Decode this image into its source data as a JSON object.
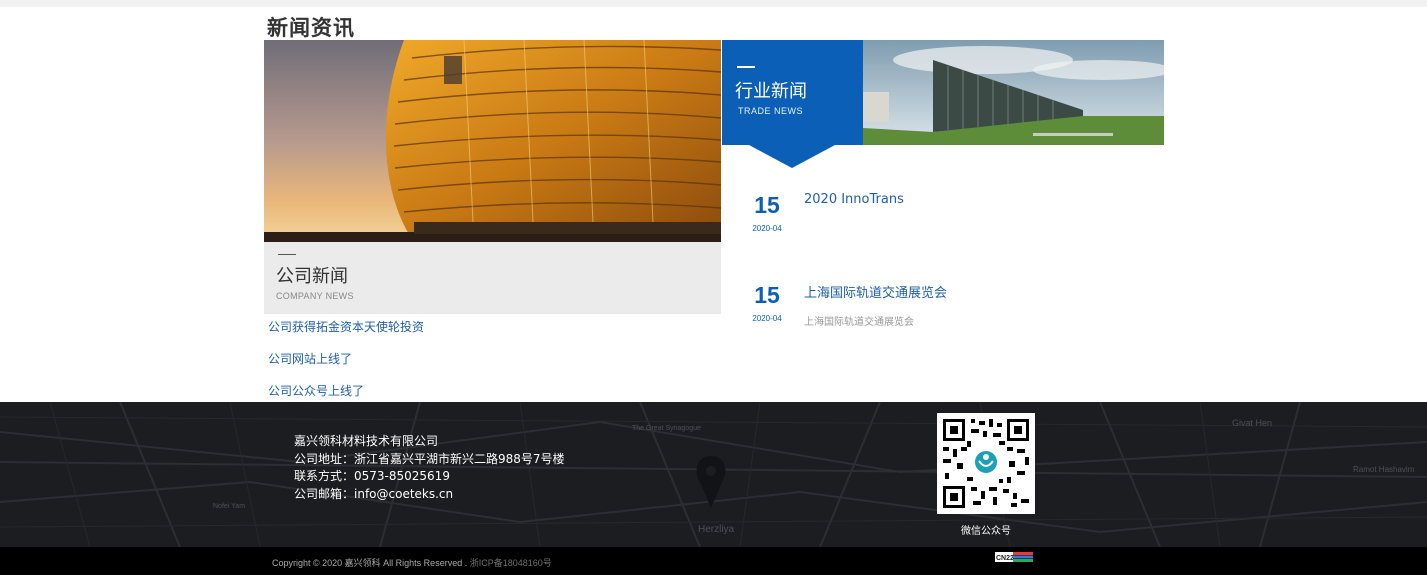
{
  "section": {
    "title": "新闻资讯"
  },
  "company_news": {
    "title": "公司新闻",
    "subtitle": "COMPANY NEWS",
    "links": [
      "公司获得拓金资本天使轮投资",
      "公司网站上线了",
      "公司公众号上线了"
    ]
  },
  "industry_news": {
    "title": "行业新闻",
    "subtitle": "TRADE NEWS",
    "items": [
      {
        "day": "15",
        "date": "2020-04",
        "title": "2020 InnoTrans",
        "summary": ""
      },
      {
        "day": "15",
        "date": "2020-04",
        "title": "上海国际轨道交通展览会",
        "summary": "上海国际轨道交通展览会"
      }
    ]
  },
  "footer": {
    "company": "嘉兴领科材料技术有限公司",
    "address": "公司地址：浙江省嘉兴平湖市新兴二路988号7号楼",
    "phone": "联系方式：0573-85025619",
    "email": "公司邮箱：info@coeteks.cn",
    "qr_caption": "微信公众号",
    "map_labels": [
      "The Great Synagogue",
      "Givat Hen",
      "Ramot Hashavim",
      "Herzliya",
      "Nofei Yam"
    ]
  },
  "copyright": {
    "text": "Copyright © 2020 嘉兴领科 All Rights Reserved .",
    "icp": "浙ICP备18048160号",
    "badge": "CN22"
  },
  "colors": {
    "brand_blue": "#0b5fb6",
    "link_blue": "#1e5fa8",
    "footer_bg": "#1c1d21"
  }
}
